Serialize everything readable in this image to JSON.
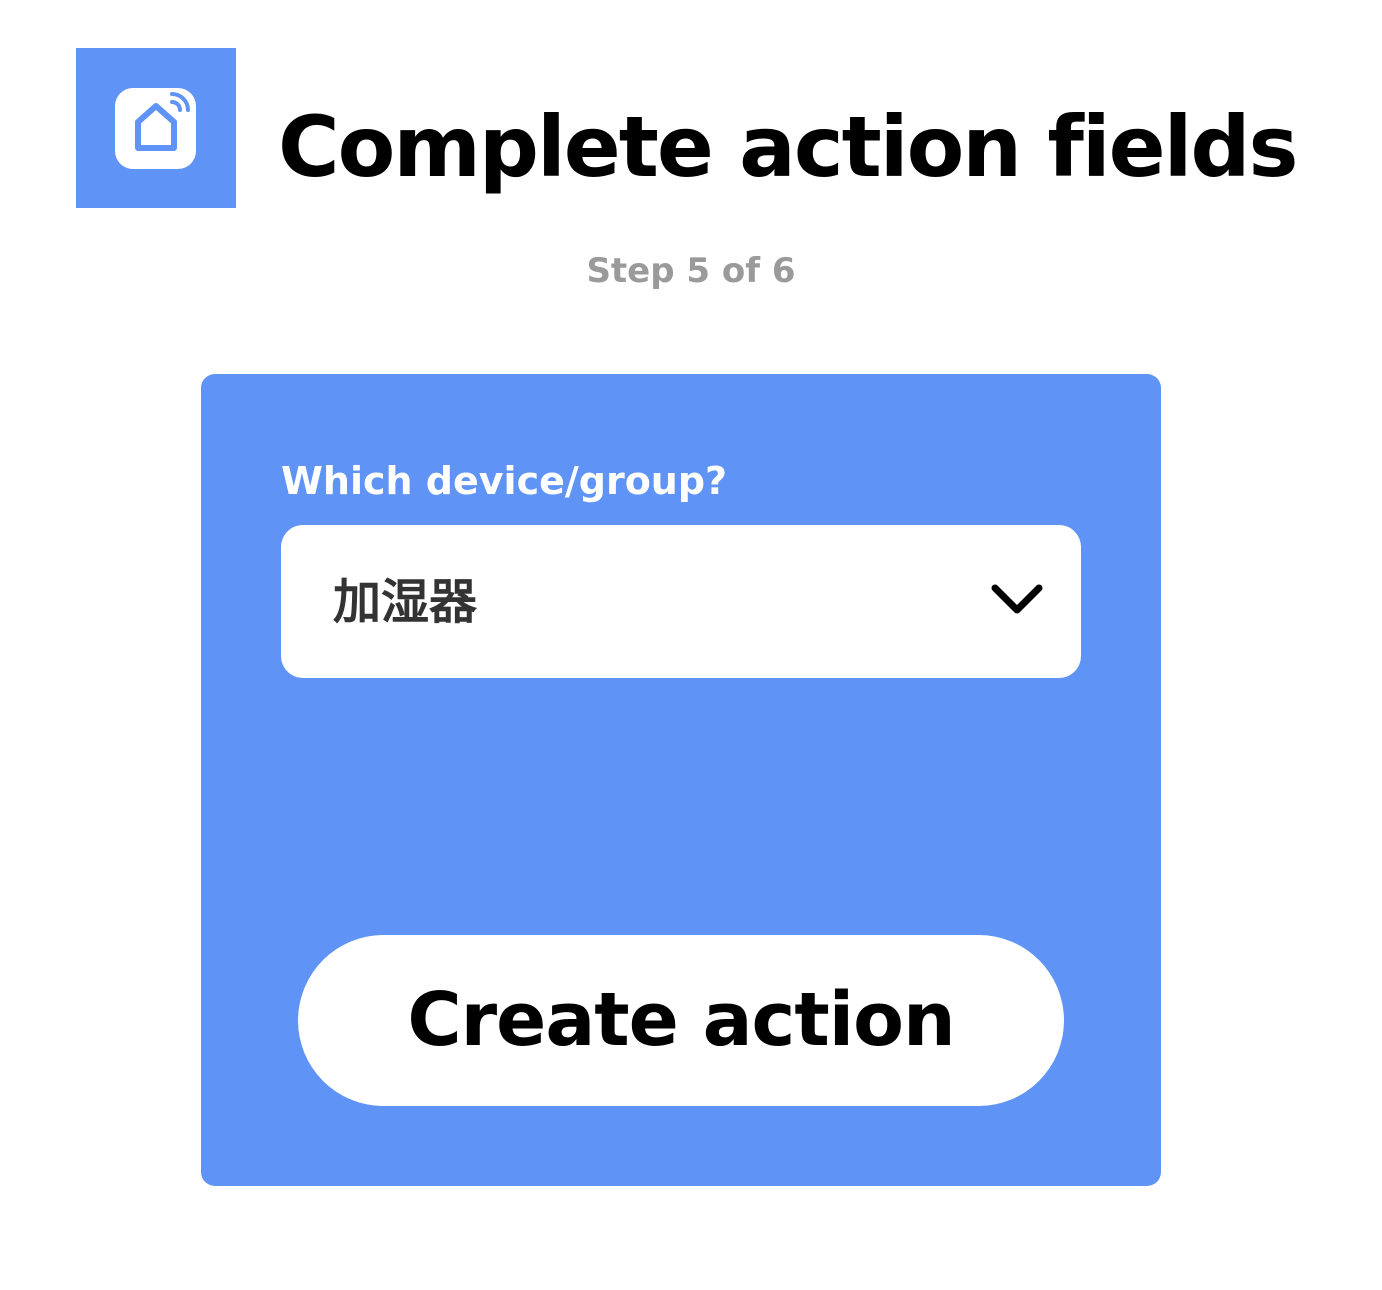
{
  "header": {
    "title": "Complete action fields",
    "step": "Step 5 of 6",
    "service_icon": "smart-home-icon"
  },
  "form": {
    "field_label": "Which device/group?",
    "device_select": {
      "selected_value": "加湿器",
      "icon": "chevron-down-icon"
    },
    "submit_label": "Create action"
  },
  "colors": {
    "accent": "#5f93f6",
    "background": "#ffffff",
    "title_text": "#000000",
    "step_text": "#9a9a9a",
    "card_label_text": "#ffffff",
    "select_text": "#333333"
  }
}
